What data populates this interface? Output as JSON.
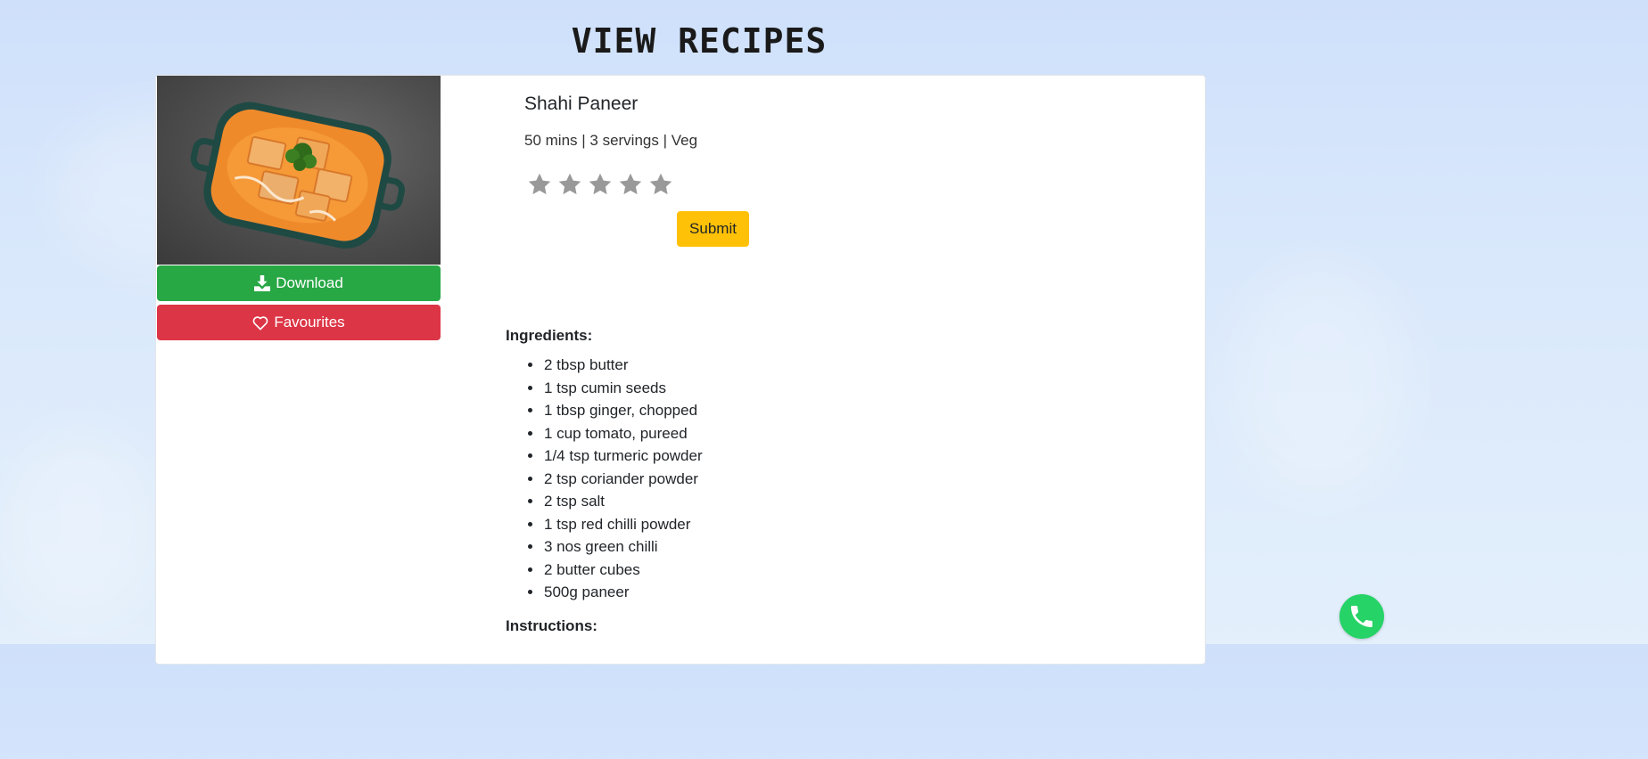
{
  "page": {
    "title": "VIEW RECIPES"
  },
  "recipe": {
    "name": "Shahi Paneer",
    "meta": "50 mins | 3 servings | Veg",
    "rating": {
      "max": 5,
      "selected": 0,
      "star_color": "#999999"
    },
    "submit_label": "Submit",
    "ingredients_heading": "Ingredients:",
    "ingredients": [
      "2 tbsp butter",
      "1 tsp cumin seeds",
      "1 tbsp ginger, chopped",
      "1 cup tomato, pureed",
      "1/4 tsp turmeric powder",
      "2 tsp coriander powder",
      "2 tsp salt",
      "1 tsp red chilli powder",
      "3 nos green chilli",
      "2 butter cubes",
      "500g paneer"
    ],
    "instructions_heading": "Instructions:"
  },
  "actions": {
    "download_label": "Download",
    "download_icon": "download-icon",
    "favourites_label": "Favourites",
    "favourites_icon": "heart-icon"
  },
  "colors": {
    "download": "#28a745",
    "favourites": "#dc3545",
    "submit": "#ffc107",
    "whatsapp": "#25d366"
  },
  "floating": {
    "icon": "whatsapp-icon"
  }
}
